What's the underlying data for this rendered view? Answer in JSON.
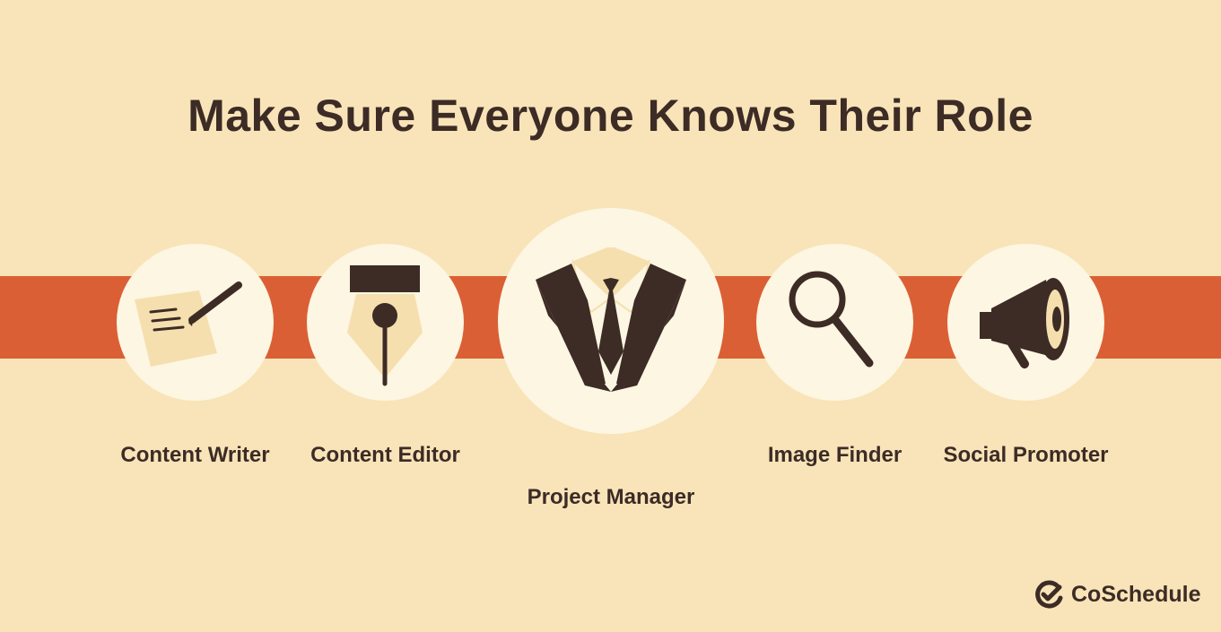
{
  "title": "Make Sure Everyone Knows Their Role",
  "colors": {
    "background": "#f8e4b8",
    "band": "#db5f35",
    "circle": "#fdf6e2",
    "dark": "#3d2b26",
    "paper": "#f5dfae"
  },
  "roles": [
    {
      "label": "Content Writer",
      "icon": "paper-pen-icon"
    },
    {
      "label": "Content Editor",
      "icon": "fountain-pen-nib-icon"
    },
    {
      "label": "Project Manager",
      "icon": "suit-tie-icon"
    },
    {
      "label": "Image Finder",
      "icon": "magnifying-glass-icon"
    },
    {
      "label": "Social Promoter",
      "icon": "megaphone-icon"
    }
  ],
  "brand": {
    "name": "CoSchedule",
    "icon": "coschedule-check-icon"
  }
}
